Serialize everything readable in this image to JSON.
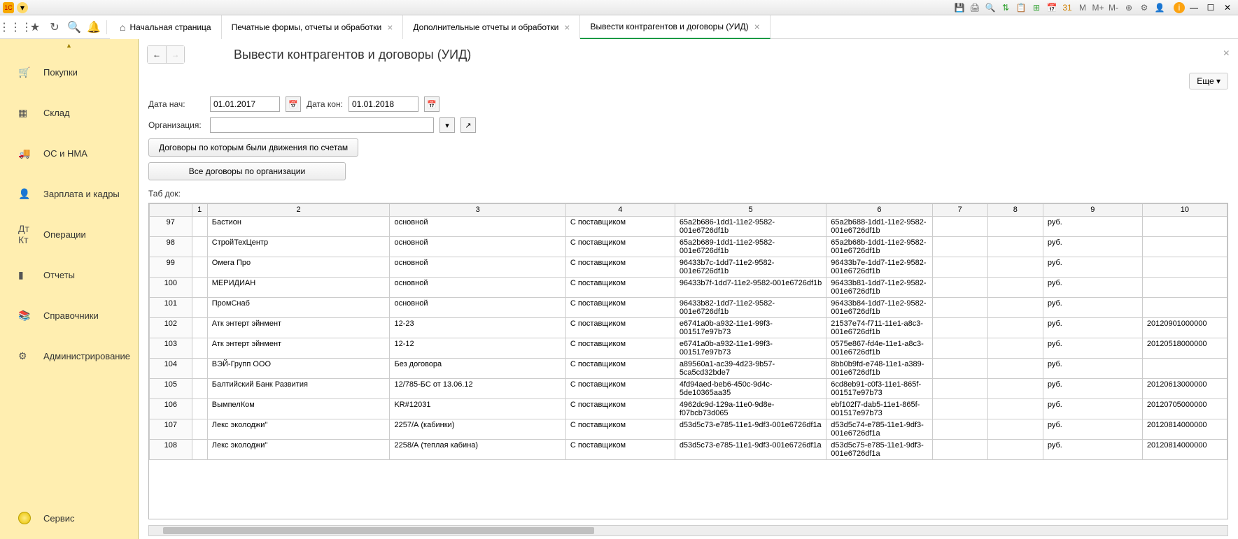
{
  "tabs": {
    "home": "Начальная страница",
    "t1": "Печатные формы, отчеты и обработки",
    "t2": "Дополнительные отчеты и обработки",
    "t3": "Вывести контрагентов и договоры (УИД)"
  },
  "sidebar": {
    "items": [
      {
        "icon": "🛒",
        "label": "Покупки"
      },
      {
        "icon": "▦",
        "label": "Склад"
      },
      {
        "icon": "🚚",
        "label": "ОС и НМА"
      },
      {
        "icon": "👤",
        "label": "Зарплата и кадры"
      },
      {
        "icon": "Дт Кт",
        "label": "Операции"
      },
      {
        "icon": "▮",
        "label": "Отчеты"
      },
      {
        "icon": "📚",
        "label": "Справочники"
      },
      {
        "icon": "⚙",
        "label": "Администрирование"
      }
    ],
    "service": "Сервис"
  },
  "page": {
    "title": "Вывести контрагентов и договоры (УИД)",
    "more": "Еще",
    "form": {
      "date_start_label": "Дата нач:",
      "date_start": "01.01.2017",
      "date_end_label": "Дата кон:",
      "date_end": "01.01.2018",
      "org_label": "Организация:",
      "btn1": "Договоры по которым были движения по счетам",
      "btn2": "Все договоры по организации",
      "tab_label": "Таб док:"
    }
  },
  "table": {
    "headers": [
      "1",
      "2",
      "3",
      "4",
      "5",
      "6",
      "7",
      "8",
      "9",
      "10"
    ],
    "rows": [
      {
        "n": "97",
        "c2": "Бастион",
        "c3": "основной",
        "c4": "С поставщиком",
        "c5": "65a2b686-1dd1-11e2-9582-001e6726df1b",
        "c6": "65a2b688-1dd1-11e2-9582-001e6726df1b",
        "c9": "руб.",
        "c10": ""
      },
      {
        "n": "98",
        "c2": "СтройТехЦентр",
        "c3": "основной",
        "c4": "С поставщиком",
        "c5": "65a2b689-1dd1-11e2-9582-001e6726df1b",
        "c6": "65a2b68b-1dd1-11e2-9582-001e6726df1b",
        "c9": "руб.",
        "c10": ""
      },
      {
        "n": "99",
        "c2": "Омега Про",
        "c3": "основной",
        "c4": "С поставщиком",
        "c5": "96433b7c-1dd7-11e2-9582-001e6726df1b",
        "c6": "96433b7e-1dd7-11e2-9582-001e6726df1b",
        "c9": "руб.",
        "c10": ""
      },
      {
        "n": "100",
        "c2": "МЕРИДИАН",
        "c3": "основной",
        "c4": "С поставщиком",
        "c5": "96433b7f-1dd7-11e2-9582-001e6726df1b",
        "c6": "96433b81-1dd7-11e2-9582-001e6726df1b",
        "c9": "руб.",
        "c10": ""
      },
      {
        "n": "101",
        "c2": "ПромСнаб",
        "c3": "основной",
        "c4": "С поставщиком",
        "c5": "96433b82-1dd7-11e2-9582-001e6726df1b",
        "c6": "96433b84-1dd7-11e2-9582-001e6726df1b",
        "c9": "руб.",
        "c10": ""
      },
      {
        "n": "102",
        "c2": "Атк энтерт эйнмент",
        "c3": "12-23",
        "c4": "С поставщиком",
        "c5": "e6741a0b-a932-11e1-99f3-001517e97b73",
        "c6": "21537e74-f711-11e1-a8c3-001e6726df1b",
        "c9": "руб.",
        "c10": "20120901000000"
      },
      {
        "n": "103",
        "c2": "Атк энтерт эйнмент",
        "c3": "12-12",
        "c4": "С поставщиком",
        "c5": "e6741a0b-a932-11e1-99f3-001517e97b73",
        "c6": "0575e867-fd4e-11e1-a8c3-001e6726df1b",
        "c9": "руб.",
        "c10": "20120518000000"
      },
      {
        "n": "104",
        "c2": "ВЭЙ-Групп ООО",
        "c3": "Без договора",
        "c4": "С поставщиком",
        "c5": "a89560a1-ac39-4d23-9b57-5ca5cd32bde7",
        "c6": "8bb0b9fd-e748-11e1-a389-001e6726df1b",
        "c9": "руб.",
        "c10": ""
      },
      {
        "n": "105",
        "c2": "Балтийский Банк Развития",
        "c3": "12/785-БС от 13.06.12",
        "c4": "С поставщиком",
        "c5": "4fd94aed-beb6-450c-9d4c-5de10365aa35",
        "c6": "6cd8eb91-c0f3-11e1-865f-001517e97b73",
        "c9": "руб.",
        "c10": "20120613000000"
      },
      {
        "n": "106",
        "c2": "ВымпелКом",
        "c3": "KR#12031",
        "c4": "С поставщиком",
        "c5": "4962dc9d-129a-11e0-9d8e-f07bcb73d065",
        "c6": "ebf102f7-dab5-11e1-865f-001517e97b73",
        "c9": "руб.",
        "c10": "20120705000000"
      },
      {
        "n": "107",
        "c2": "Лекс эколоджи\"",
        "c3": "2257/А (кабинки)",
        "c4": "С поставщиком",
        "c5": "d53d5c73-e785-11e1-9df3-001e6726df1a",
        "c6": "d53d5c74-e785-11e1-9df3-001e6726df1a",
        "c9": "руб.",
        "c10": "20120814000000"
      },
      {
        "n": "108",
        "c2": "Лекс эколоджи\"",
        "c3": "2258/А (теплая кабина)",
        "c4": "С поставщиком",
        "c5": "d53d5c73-e785-11e1-9df3-001e6726df1a",
        "c6": "d53d5c75-e785-11e1-9df3-001e6726df1a",
        "c9": "руб.",
        "c10": "20120814000000"
      }
    ]
  }
}
